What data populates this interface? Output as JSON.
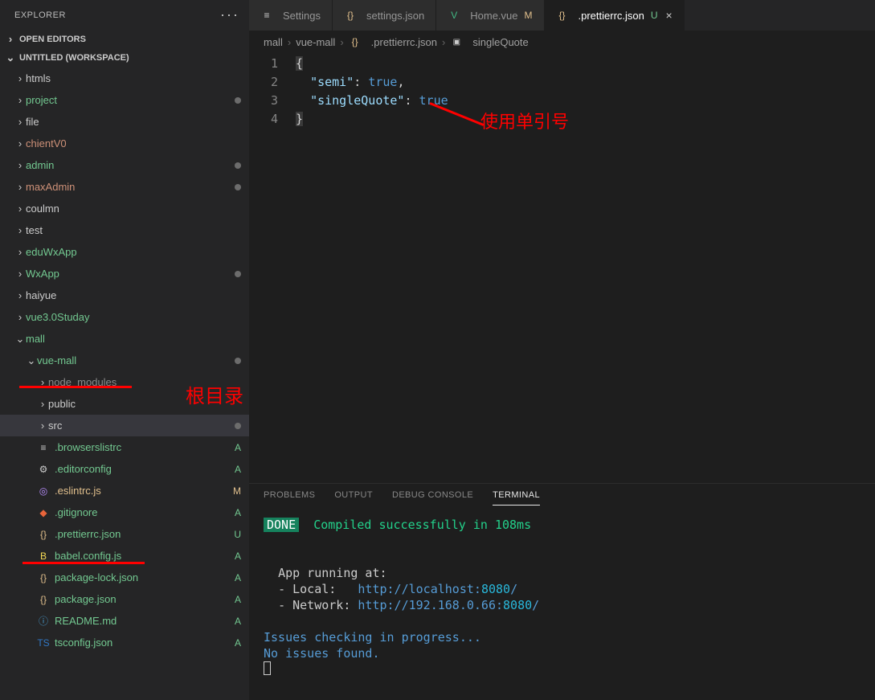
{
  "sidebar": {
    "title": "EXPLORER",
    "sections": {
      "openEditors": "OPEN EDITORS",
      "workspace": "UNTITLED (WORKSPACE)"
    },
    "tree": [
      {
        "indent": 0,
        "chev": "›",
        "label": "htmls",
        "color": "default"
      },
      {
        "indent": 0,
        "chev": "›",
        "label": "project",
        "color": "green",
        "dot": true
      },
      {
        "indent": 0,
        "chev": "›",
        "label": "file",
        "color": "default"
      },
      {
        "indent": 0,
        "chev": "›",
        "label": "chientV0",
        "color": "orange"
      },
      {
        "indent": 0,
        "chev": "›",
        "label": "admin",
        "color": "green",
        "dot": true
      },
      {
        "indent": 0,
        "chev": "›",
        "label": "maxAdmin",
        "color": "orange",
        "dot": true
      },
      {
        "indent": 0,
        "chev": "›",
        "label": "coulmn",
        "color": "default"
      },
      {
        "indent": 0,
        "chev": "›",
        "label": "test",
        "color": "default"
      },
      {
        "indent": 0,
        "chev": "›",
        "label": "eduWxApp",
        "color": "green"
      },
      {
        "indent": 0,
        "chev": "›",
        "label": "WxApp",
        "color": "green",
        "dot": true
      },
      {
        "indent": 0,
        "chev": "›",
        "label": "haiyue",
        "color": "default"
      },
      {
        "indent": 0,
        "chev": "›",
        "label": "vue3.0Studay",
        "color": "green"
      },
      {
        "indent": 0,
        "chev": "⌄",
        "label": "mall",
        "color": "green"
      },
      {
        "indent": 1,
        "chev": "⌄",
        "label": "vue-mall",
        "color": "green",
        "dot": true,
        "underlineRed": true
      },
      {
        "indent": 2,
        "chev": "›",
        "label": "node_modules",
        "color": "gray"
      },
      {
        "indent": 2,
        "chev": "›",
        "label": "public",
        "color": "default"
      },
      {
        "indent": 2,
        "chev": "›",
        "label": "src",
        "color": "default",
        "dot": true,
        "selected": true
      },
      {
        "indent": 2,
        "icon": "lines",
        "label": ".browserslistrc",
        "color": "green",
        "status": "A"
      },
      {
        "indent": 2,
        "icon": "gear",
        "label": ".editorconfig",
        "color": "green",
        "status": "A"
      },
      {
        "indent": 2,
        "icon": "eslint",
        "label": ".eslintrc.js",
        "color": "yellow",
        "status": "M"
      },
      {
        "indent": 2,
        "icon": "git",
        "label": ".gitignore",
        "color": "green",
        "status": "A"
      },
      {
        "indent": 2,
        "icon": "json",
        "label": ".prettierrc.json",
        "color": "green",
        "status": "U",
        "underlineRed": true
      },
      {
        "indent": 2,
        "icon": "babel",
        "label": "babel.config.js",
        "color": "green",
        "status": "A"
      },
      {
        "indent": 2,
        "icon": "json",
        "label": "package-lock.json",
        "color": "green",
        "status": "A"
      },
      {
        "indent": 2,
        "icon": "json",
        "label": "package.json",
        "color": "green",
        "status": "A"
      },
      {
        "indent": 2,
        "icon": "info",
        "label": "README.md",
        "color": "green",
        "status": "A"
      },
      {
        "indent": 2,
        "icon": "ts",
        "label": "tsconfig.json",
        "color": "green",
        "status": "A"
      }
    ]
  },
  "tabs": [
    {
      "icon": "settings",
      "label": "Settings",
      "active": false
    },
    {
      "icon": "json",
      "label": "settings.json",
      "active": false
    },
    {
      "icon": "vue",
      "label": "Home.vue",
      "badge": "M",
      "badgeClass": "status-M",
      "active": false
    },
    {
      "icon": "json",
      "label": ".prettierrc.json",
      "badge": "U",
      "badgeClass": "status-U",
      "active": true,
      "close": true
    }
  ],
  "breadcrumb": [
    "mall",
    "vue-mall",
    ".prettierrc.json",
    "singleQuote"
  ],
  "editor": {
    "lines": [
      "1",
      "2",
      "3",
      "4"
    ],
    "code": {
      "semi_key": "\"semi\"",
      "semi_val": "true",
      "singleQuote_key": "\"singleQuote\"",
      "singleQuote_val": "true"
    }
  },
  "annotations": {
    "rootDir": "根目录",
    "singleQuote": "使用单引号"
  },
  "panel": {
    "tabs": [
      "PROBLEMS",
      "OUTPUT",
      "DEBUG CONSOLE",
      "TERMINAL"
    ],
    "active": 3,
    "terminal": {
      "done": "DONE",
      "compiled": "Compiled successfully in 108ms",
      "appRunning": "App running at:",
      "localLabel": "- Local:   ",
      "localUrl": "http://localhost:",
      "localPort": "8080",
      "networkLabel": "- Network: ",
      "networkUrl": "http://192.168.0.66:",
      "networkPort": "8080",
      "issues1": "Issues checking in progress...",
      "issues2": "No issues found."
    }
  },
  "icons": {
    "lines": "≡",
    "gear": "⚙",
    "eslint": "◎",
    "git": "◆",
    "json": "{}",
    "babel": "B",
    "info": "ⓘ",
    "ts": "TS",
    "settings": "≡",
    "vue": "V"
  },
  "iconColors": {
    "lines": "#cccccc",
    "gear": "#cccccc",
    "eslint": "#b98eff",
    "git": "#e8643a",
    "json": "#e2c08d",
    "babel": "#f5da55",
    "info": "#4a9fd4",
    "ts": "#3178c6",
    "settings": "#cccccc",
    "vue": "#41b883"
  }
}
